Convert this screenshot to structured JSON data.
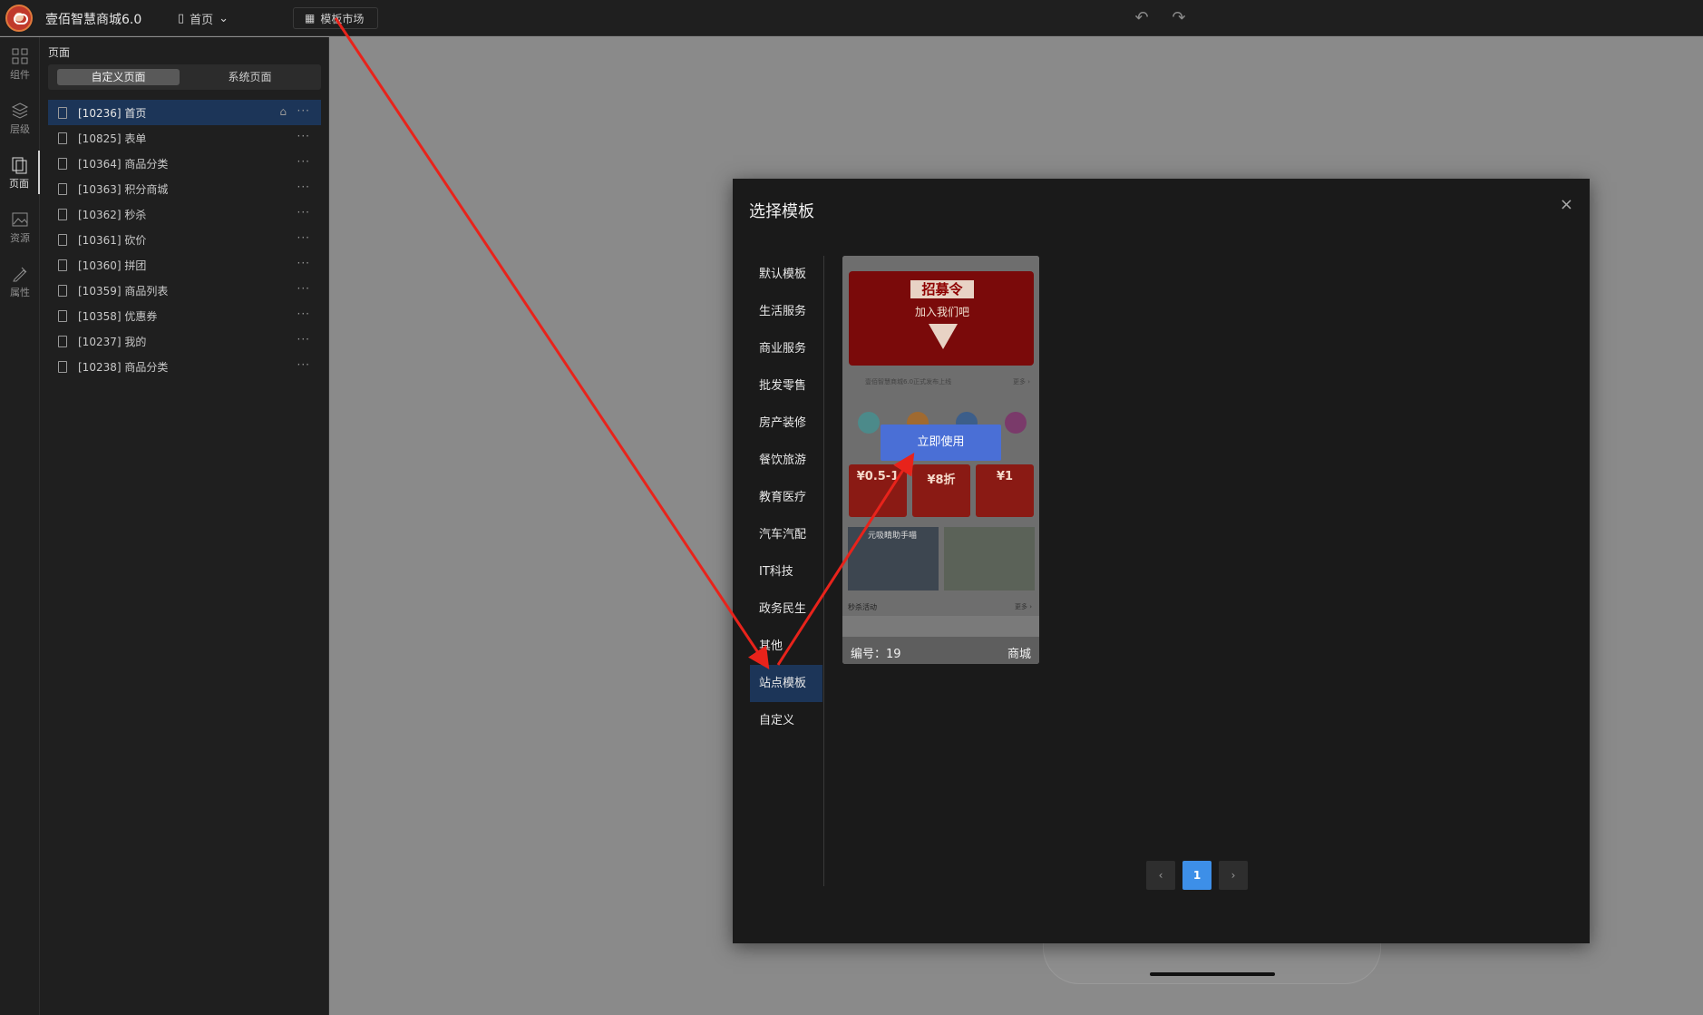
{
  "topbar": {
    "app_title": "壹佰智慧商城6.0",
    "page_select": "首页",
    "market_button": "模板市场"
  },
  "rail": [
    {
      "label": "组件",
      "icon": "grid-icon"
    },
    {
      "label": "层级",
      "icon": "layers-icon"
    },
    {
      "label": "页面",
      "icon": "pages-icon"
    },
    {
      "label": "资源",
      "icon": "image-icon"
    },
    {
      "label": "属性",
      "icon": "edit-icon"
    }
  ],
  "panel": {
    "title": "页面",
    "tab_custom": "自定义页面",
    "tab_system": "系统页面",
    "pages": [
      {
        "label": "[10236] 首页",
        "home": true
      },
      {
        "label": "[10825] 表单"
      },
      {
        "label": "[10364] 商品分类"
      },
      {
        "label": "[10363] 积分商城"
      },
      {
        "label": "[10362] 秒杀"
      },
      {
        "label": "[10361] 砍价"
      },
      {
        "label": "[10360] 拼团"
      },
      {
        "label": "[10359] 商品列表"
      },
      {
        "label": "[10358] 优惠券"
      },
      {
        "label": "[10237] 我的"
      },
      {
        "label": "[10238] 商品分类"
      }
    ],
    "more": "···",
    "home_icon": "⌂"
  },
  "modal": {
    "title": "选择模板",
    "close": "×",
    "categories": [
      "默认模板",
      "生活服务",
      "商业服务",
      "批发零售",
      "房产装修",
      "餐饮旅游",
      "教育医疗",
      "汽车汽配",
      "IT科技",
      "政务民生",
      "其他",
      "站点模板",
      "自定义"
    ],
    "active_category": "站点模板",
    "card": {
      "banner_line1": "招募令",
      "banner_line2": "加入我们吧",
      "notice": "壹佰智慧商城6.0正式发布上线",
      "notice_more": "更多 ›",
      "coupons": [
        "¥0.5-1",
        "¥8折",
        "¥1"
      ],
      "promo_text": "元吸睛助手喵",
      "section_title": "秒杀活动",
      "section_more": "更多 ›",
      "number": "编号：19",
      "type": "商城",
      "use_button": "立即使用"
    },
    "pager": {
      "prev": "‹",
      "current": "1",
      "next": "›"
    }
  },
  "colors": {
    "arrow": "#e8231b",
    "active_blue": "#3d8fe8",
    "use_button": "#4a6fd6"
  }
}
